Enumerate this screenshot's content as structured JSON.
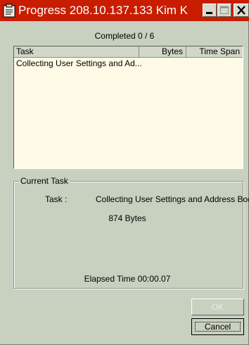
{
  "window": {
    "title": "Progress 208.10.137.133 Kim K",
    "accent_color": "#c81d00",
    "title_icon": "clipboard-icon"
  },
  "titlebar_buttons": {
    "minimize": "minimize-icon",
    "maximize": "maximize-icon",
    "close": "close-icon"
  },
  "status": {
    "completed": "Completed 0 / 6"
  },
  "task_list": {
    "columns": [
      "Task",
      "Bytes",
      "Time Span"
    ],
    "rows": [
      {
        "task": "Collecting User Settings and Ad...",
        "bytes": "",
        "time_span": ""
      }
    ]
  },
  "current_task": {
    "group_label": "Current Task",
    "task_label": "Task :",
    "task_value": "Collecting User Settings and Address Book",
    "bytes": "874 Bytes",
    "elapsed": "Elapsed Time 00:00.07"
  },
  "buttons": {
    "ok": "OK",
    "cancel": "Cancel"
  }
}
